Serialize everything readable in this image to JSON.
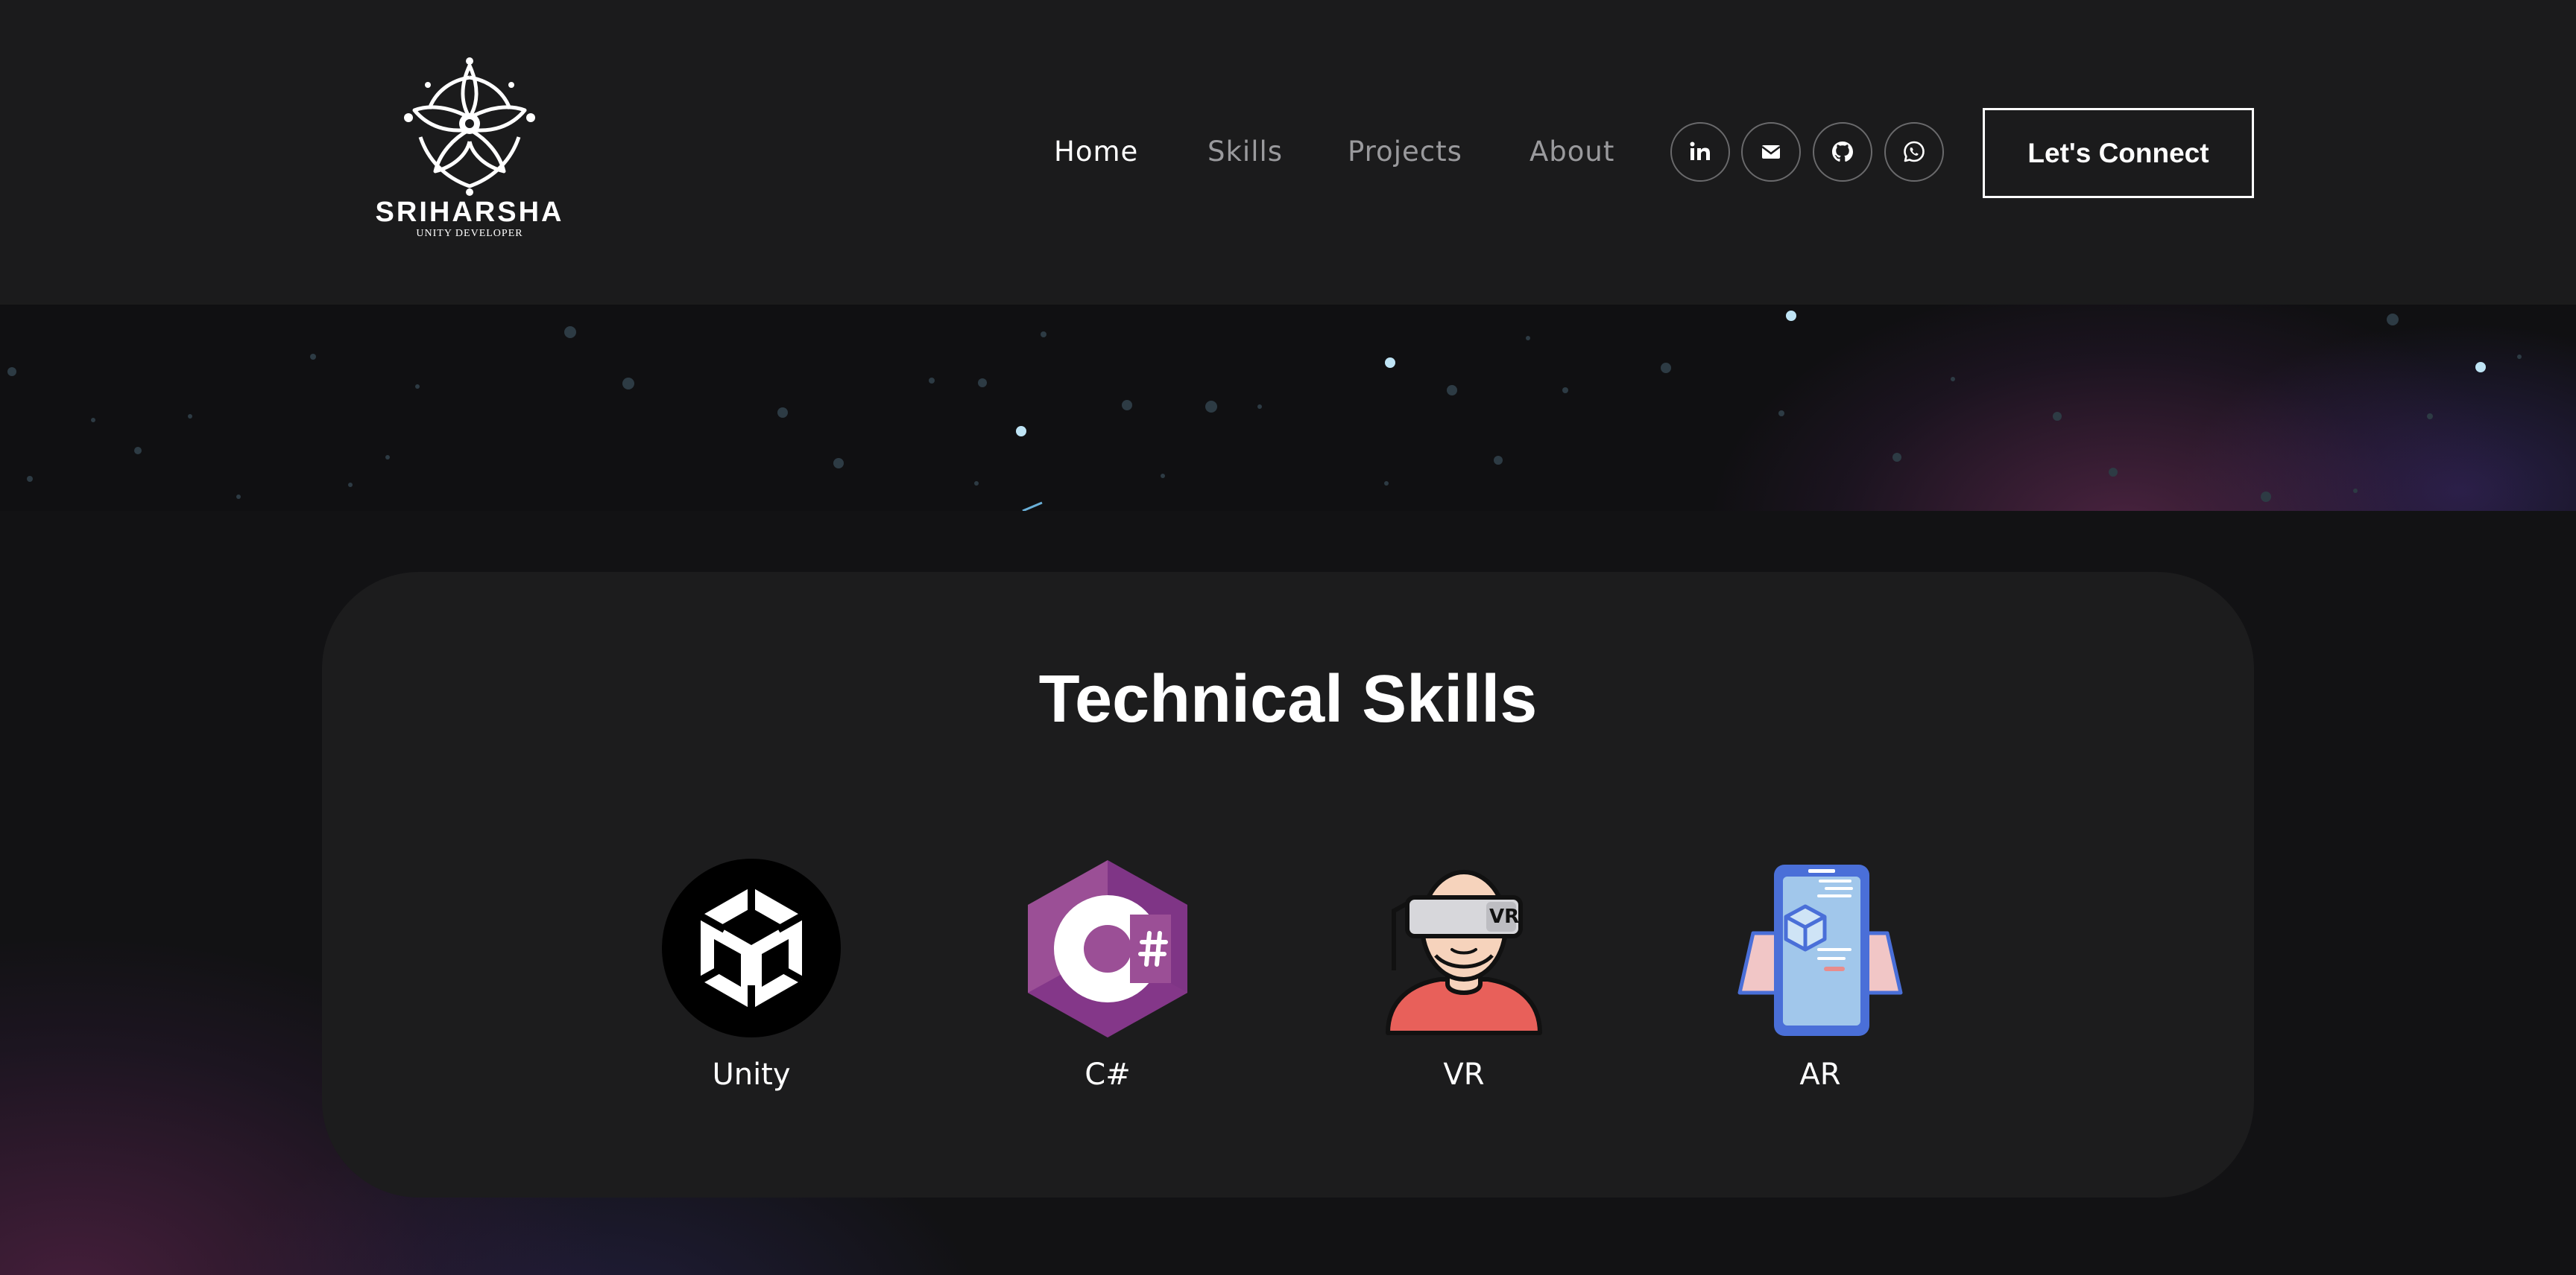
{
  "brand": {
    "name": "SRIHARSHA",
    "tagline": "UNITY DEVELOPER"
  },
  "nav": {
    "links": [
      {
        "label": "Home",
        "active": true
      },
      {
        "label": "Skills",
        "active": false
      },
      {
        "label": "Projects",
        "active": false
      },
      {
        "label": "About",
        "active": false
      }
    ],
    "social_icons": [
      "linkedin-icon",
      "email-icon",
      "github-icon",
      "whatsapp-icon"
    ],
    "cta_label": "Let's Connect"
  },
  "skills": {
    "title": "Technical Skills",
    "items": [
      {
        "label": "Unity",
        "icon": "unity-icon"
      },
      {
        "label": "C#",
        "icon": "csharp-icon"
      },
      {
        "label": "VR",
        "icon": "vr-headset-icon"
      },
      {
        "label": "AR",
        "icon": "ar-phone-icon"
      }
    ]
  },
  "colors": {
    "navbar_bg": "#1b1b1c",
    "page_bg": "#121214",
    "card_bg": "#1c1c1d",
    "nav_inactive": "#9a9a9d",
    "csharp_purple": "#9b4f96",
    "vr_shirt": "#e8605a",
    "ar_phone": "#4a6fd8"
  }
}
